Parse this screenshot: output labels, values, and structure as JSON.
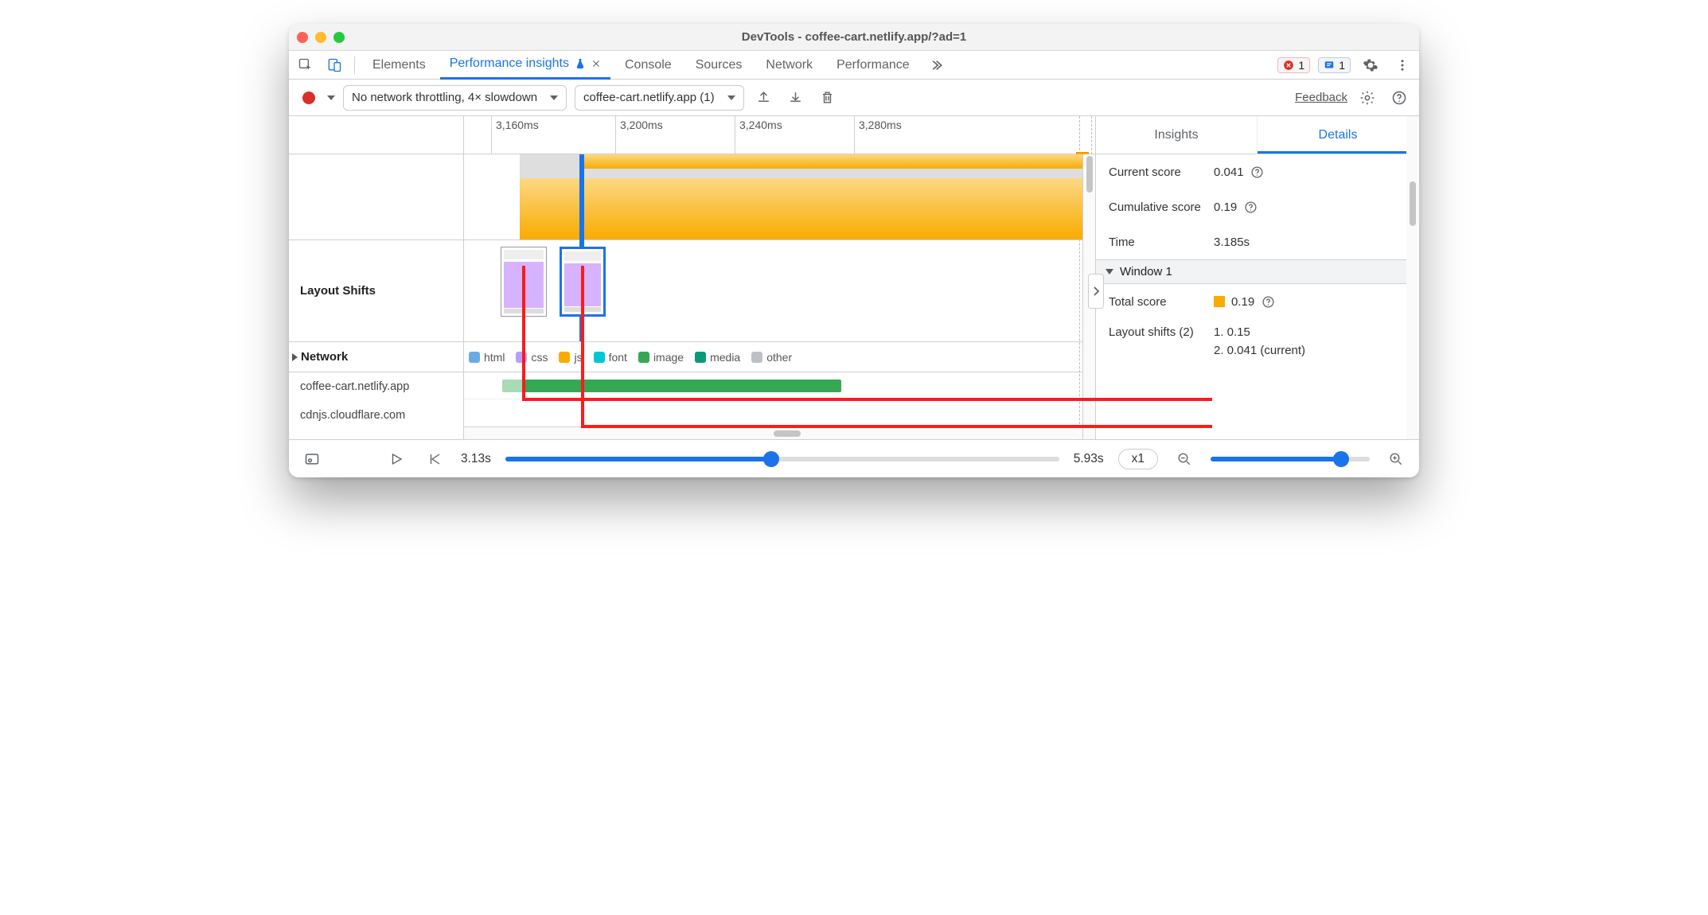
{
  "window": {
    "title": "DevTools - coffee-cart.netlify.app/?ad=1"
  },
  "top_tabs": {
    "elements": "Elements",
    "perf_insights": "Performance insights",
    "console": "Console",
    "sources": "Sources",
    "network": "Network",
    "performance": "Performance"
  },
  "badges": {
    "errors": "1",
    "issues": "1"
  },
  "controls": {
    "throttle": "No network throttling, 4× slowdown",
    "recording": "coffee-cart.netlify.app (1)",
    "feedback": "Feedback"
  },
  "timeline": {
    "ticks": [
      "3,160ms",
      "3,200ms",
      "3,240ms",
      "3,280ms"
    ],
    "section_layout_shifts": "Layout Shifts",
    "section_network": "Network",
    "domains": [
      "coffee-cart.netlify.app",
      "cdnjs.cloudflare.com"
    ],
    "legend": {
      "html": "html",
      "css": "css",
      "js": "js",
      "font": "font",
      "image": "image",
      "media": "media",
      "other": "other"
    }
  },
  "right": {
    "tabs": {
      "insights": "Insights",
      "details": "Details"
    },
    "current_score_k": "Current score",
    "current_score_v": "0.041",
    "cumulative_score_k": "Cumulative score",
    "cumulative_score_v": "0.19",
    "time_k": "Time",
    "time_v": "3.185s",
    "window_section": "Window 1",
    "total_score_k": "Total score",
    "total_score_v": "0.19",
    "ls_k": "Layout shifts (2)",
    "ls1": "1. 0.15",
    "ls2": "2. 0.041 (current)"
  },
  "playback": {
    "start": "3.13s",
    "end": "5.93s",
    "speed": "x1"
  },
  "colors": {
    "accent": "#1a73e8",
    "js": "#F9AB00",
    "image": "#34A853",
    "red": "#ff1a1a"
  }
}
